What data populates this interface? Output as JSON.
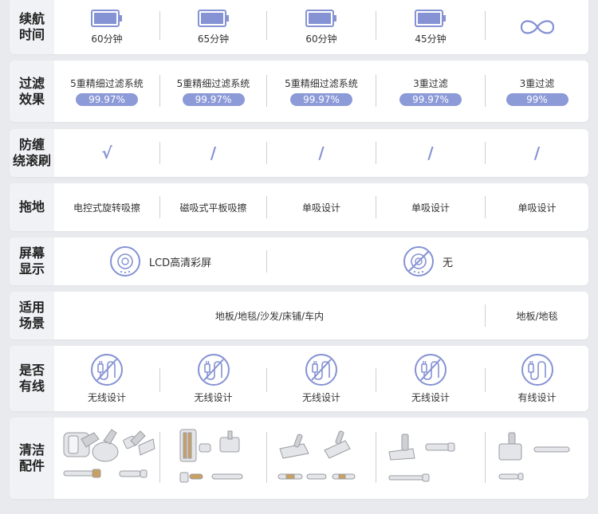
{
  "colors": {
    "accent": "#8592d4",
    "pill": "#8d9ad8",
    "label_bg": "#f1f2f5",
    "page_bg": "#e9eaee"
  },
  "battery": {
    "label_1": "续航",
    "label_2": "时间",
    "cells": [
      {
        "icon": "battery-icon",
        "text": "60分钟"
      },
      {
        "icon": "battery-icon",
        "text": "65分钟"
      },
      {
        "icon": "battery-icon",
        "text": "60分钟"
      },
      {
        "icon": "battery-icon",
        "text": "45分钟"
      },
      {
        "icon": "infinity-icon",
        "text": ""
      }
    ]
  },
  "filter": {
    "label_1": "过滤",
    "label_2": "效果",
    "cells": [
      {
        "text": "5重精细过滤系统",
        "pill": "99.97%"
      },
      {
        "text": "5重精细过滤系统",
        "pill": "99.97%"
      },
      {
        "text": "5重精细过滤系统",
        "pill": "99.97%"
      },
      {
        "text": "3重过滤",
        "pill": "99.97%"
      },
      {
        "text": "3重过滤",
        "pill": "99%"
      }
    ]
  },
  "anti_tangle": {
    "label_1": "防缠",
    "label_2": "绕滚刷",
    "cells": [
      "√",
      "/",
      "/",
      "/",
      "/"
    ]
  },
  "mop": {
    "label_1": "拖地",
    "cells": [
      "电控式旋转吸擦",
      "磁吸式平板吸擦",
      "单吸设计",
      "单吸设计",
      "单吸设计"
    ]
  },
  "screen": {
    "label_1": "屏幕",
    "label_2": "显示",
    "cells": [
      {
        "icon": "lcd-screen-icon",
        "text": "LCD高清彩屏"
      },
      {
        "icon": "no-screen-icon",
        "text": "无"
      }
    ]
  },
  "scene": {
    "label_1": "适用",
    "label_2": "场景",
    "cells": [
      "地板/地毯/沙发/床铺/车内",
      "地板/地毯"
    ]
  },
  "wired": {
    "label_1": "是否",
    "label_2": "有线",
    "cells": [
      {
        "icon": "no-cord-icon",
        "text": "无线设计"
      },
      {
        "icon": "no-cord-icon",
        "text": "无线设计"
      },
      {
        "icon": "no-cord-icon",
        "text": "无线设计"
      },
      {
        "icon": "no-cord-icon",
        "text": "无线设计"
      },
      {
        "icon": "cord-icon",
        "text": "有线设计"
      }
    ]
  },
  "accessories": {
    "label_1": "清洁",
    "label_2": "配件",
    "cells": [
      "accessory-set-1",
      "accessory-set-2",
      "accessory-set-3",
      "accessory-set-4",
      "accessory-set-5"
    ]
  }
}
